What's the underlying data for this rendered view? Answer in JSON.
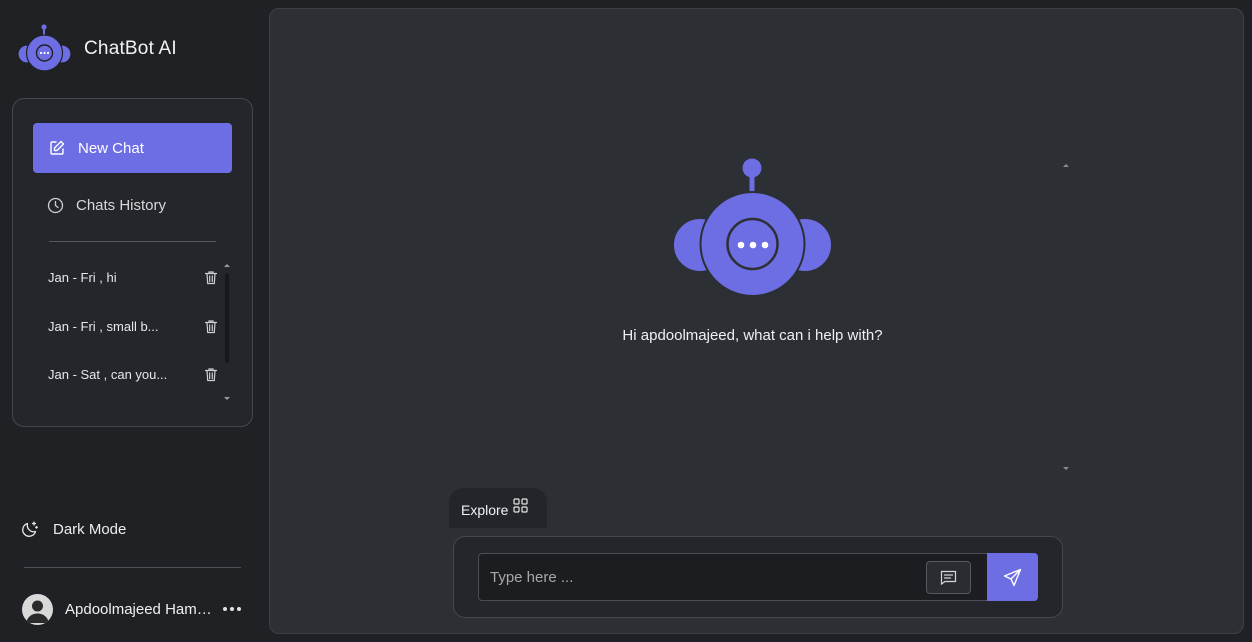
{
  "app": {
    "title": "ChatBot AI"
  },
  "sidebar": {
    "new_chat_label": "New Chat",
    "history_label": "Chats History",
    "history": [
      {
        "text": "Jan - Fri , hi"
      },
      {
        "text": "Jan - Fri , small b..."
      },
      {
        "text": "Jan - Sat , can you..."
      }
    ],
    "dark_mode_label": "Dark Mode",
    "user_name": "Apdoolmajeed Hamz..."
  },
  "main": {
    "greeting": "Hi apdoolmajeed, what can i help with?",
    "explore_label": "Explore",
    "input_placeholder": "Type here ..."
  },
  "colors": {
    "accent": "#6d6ee3",
    "background": "#1f2125",
    "panel": "#2c2f34"
  },
  "icons": [
    "robot-logo-icon",
    "edit-icon",
    "clock-icon",
    "trash-icon",
    "moon-icon",
    "user-icon",
    "more-icon",
    "grid-icon",
    "message-icon",
    "send-icon"
  ]
}
